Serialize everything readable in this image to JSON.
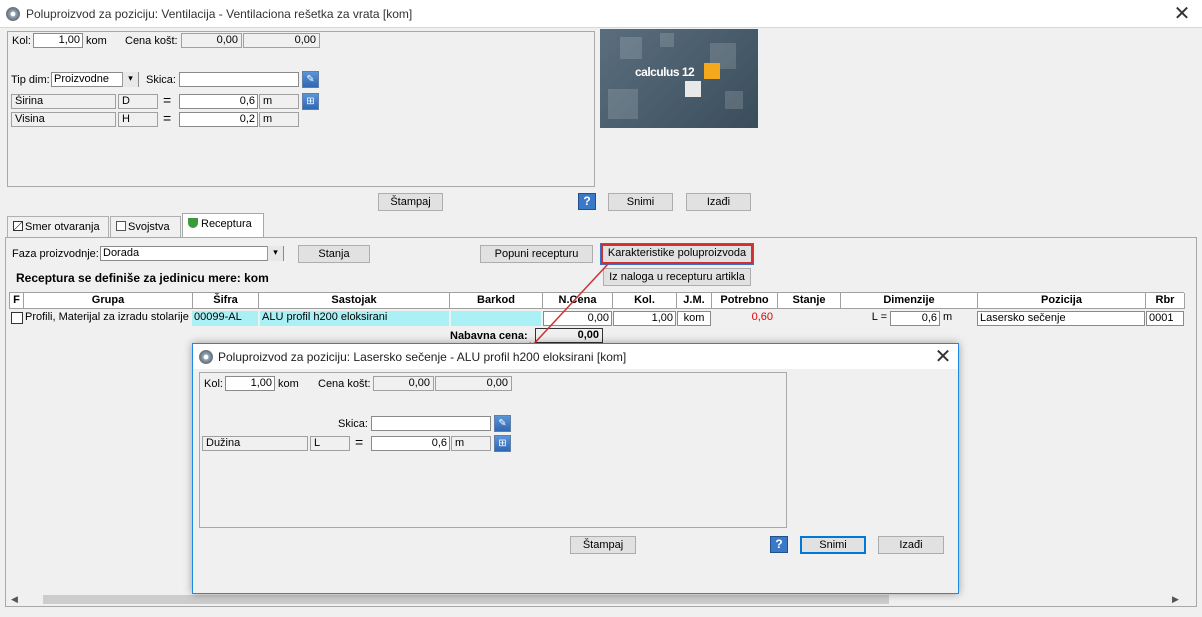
{
  "window": {
    "title": "Poluproizvod za poziciju: Ventilacija - Ventilaciona rešetka za vrata [kom]"
  },
  "top": {
    "kol_label": "Kol:",
    "kol_value": "1,00",
    "kol_unit": "kom",
    "cena_label": "Cena košt:",
    "cena_value1": "0,00",
    "cena_value2": "0,00",
    "tipdim_label": "Tip dim:",
    "tipdim_value": "Proizvodne",
    "skica_label": "Skica:",
    "skica_value": "",
    "dims": [
      {
        "name": "Širina",
        "code": "D",
        "eq": "=",
        "value": "0,6",
        "unit": "m"
      },
      {
        "name": "Visina",
        "code": "H",
        "eq": "=",
        "value": "0,2",
        "unit": "m"
      }
    ]
  },
  "logo": {
    "text": "calculus 12"
  },
  "buttons": {
    "stampaj": "Štampaj",
    "help": "?",
    "snimi": "Snimi",
    "izadji": "Izađi"
  },
  "tabs": [
    {
      "label": "Smer otvaranja"
    },
    {
      "label": "Svojstva"
    },
    {
      "label": "Receptura"
    }
  ],
  "receptura": {
    "faza_label": "Faza proizvodnje:",
    "faza_value": "Dorada",
    "stanja_btn": "Stanja",
    "popuni_btn": "Popuni recepturu",
    "karakteristike_btn": "Karakteristike poluproizvoda",
    "iz_naloga_btn": "Iz naloga u recepturu artikla",
    "info": "Receptura se definiše za jedinicu mere: kom",
    "columns": [
      "F",
      "Grupa",
      "Šifra",
      "Sastojak",
      "Barkod",
      "N.Cena",
      "Kol.",
      "J.M.",
      "Potrebno",
      "Stanje",
      "Dimenzije",
      "Pozicija",
      "Rbr"
    ],
    "row": {
      "grupa": "Profili, Materijal za izradu stolarije",
      "sifra": "00099-AL",
      "sastojak": "ALU profil h200 eloksirani",
      "barkod": "",
      "ncena": "0,00",
      "kol": "1,00",
      "jm": "kom",
      "potrebno": "0,60",
      "stanje": "",
      "dim_label": "L =",
      "dim_value": "0,6",
      "dim_unit": "m",
      "pozicija": "Lasersko sečenje",
      "rbr": "0001"
    },
    "nabavna_label": "Nabavna cena:",
    "nabavna_value": "0,00"
  },
  "dialog": {
    "title": "Poluproizvod za poziciju: Lasersko sečenje - ALU profil h200 eloksirani [kom]",
    "kol_label": "Kol:",
    "kol_value": "1,00",
    "kol_unit": "kom",
    "cena_label": "Cena košt:",
    "cena_value1": "0,00",
    "cena_value2": "0,00",
    "skica_label": "Skica:",
    "skica_value": "",
    "dim": {
      "name": "Dužina",
      "code": "L",
      "eq": "=",
      "value": "0,6",
      "unit": "m"
    },
    "stampaj": "Štampaj",
    "help": "?",
    "snimi": "Snimi",
    "izadji": "Izađi"
  },
  "colors": {
    "highlight_red": "#d03030",
    "cyan_cell": "#aaf0f4",
    "potrebno_red": "#e00000",
    "accent": "#1e88e5"
  }
}
